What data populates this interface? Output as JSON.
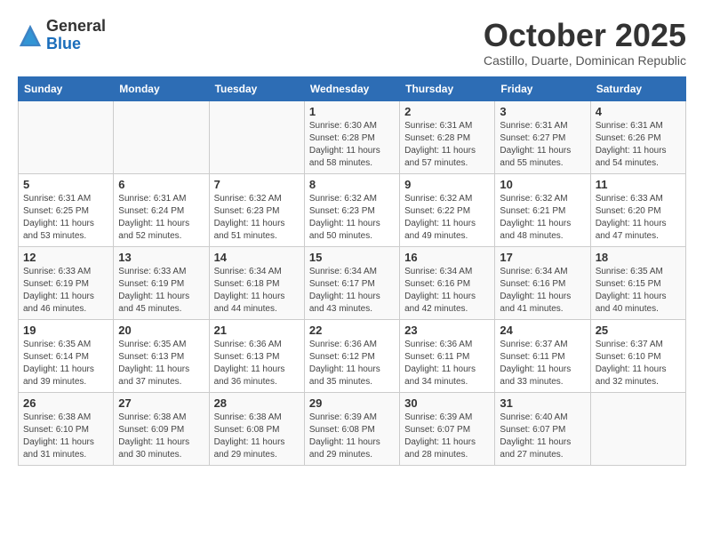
{
  "header": {
    "logo_general": "General",
    "logo_blue": "Blue",
    "month": "October 2025",
    "location": "Castillo, Duarte, Dominican Republic"
  },
  "days_of_week": [
    "Sunday",
    "Monday",
    "Tuesday",
    "Wednesday",
    "Thursday",
    "Friday",
    "Saturday"
  ],
  "weeks": [
    [
      {
        "day": "",
        "info": ""
      },
      {
        "day": "",
        "info": ""
      },
      {
        "day": "",
        "info": ""
      },
      {
        "day": "1",
        "info": "Sunrise: 6:30 AM\nSunset: 6:28 PM\nDaylight: 11 hours\nand 58 minutes."
      },
      {
        "day": "2",
        "info": "Sunrise: 6:31 AM\nSunset: 6:28 PM\nDaylight: 11 hours\nand 57 minutes."
      },
      {
        "day": "3",
        "info": "Sunrise: 6:31 AM\nSunset: 6:27 PM\nDaylight: 11 hours\nand 55 minutes."
      },
      {
        "day": "4",
        "info": "Sunrise: 6:31 AM\nSunset: 6:26 PM\nDaylight: 11 hours\nand 54 minutes."
      }
    ],
    [
      {
        "day": "5",
        "info": "Sunrise: 6:31 AM\nSunset: 6:25 PM\nDaylight: 11 hours\nand 53 minutes."
      },
      {
        "day": "6",
        "info": "Sunrise: 6:31 AM\nSunset: 6:24 PM\nDaylight: 11 hours\nand 52 minutes."
      },
      {
        "day": "7",
        "info": "Sunrise: 6:32 AM\nSunset: 6:23 PM\nDaylight: 11 hours\nand 51 minutes."
      },
      {
        "day": "8",
        "info": "Sunrise: 6:32 AM\nSunset: 6:23 PM\nDaylight: 11 hours\nand 50 minutes."
      },
      {
        "day": "9",
        "info": "Sunrise: 6:32 AM\nSunset: 6:22 PM\nDaylight: 11 hours\nand 49 minutes."
      },
      {
        "day": "10",
        "info": "Sunrise: 6:32 AM\nSunset: 6:21 PM\nDaylight: 11 hours\nand 48 minutes."
      },
      {
        "day": "11",
        "info": "Sunrise: 6:33 AM\nSunset: 6:20 PM\nDaylight: 11 hours\nand 47 minutes."
      }
    ],
    [
      {
        "day": "12",
        "info": "Sunrise: 6:33 AM\nSunset: 6:19 PM\nDaylight: 11 hours\nand 46 minutes."
      },
      {
        "day": "13",
        "info": "Sunrise: 6:33 AM\nSunset: 6:19 PM\nDaylight: 11 hours\nand 45 minutes."
      },
      {
        "day": "14",
        "info": "Sunrise: 6:34 AM\nSunset: 6:18 PM\nDaylight: 11 hours\nand 44 minutes."
      },
      {
        "day": "15",
        "info": "Sunrise: 6:34 AM\nSunset: 6:17 PM\nDaylight: 11 hours\nand 43 minutes."
      },
      {
        "day": "16",
        "info": "Sunrise: 6:34 AM\nSunset: 6:16 PM\nDaylight: 11 hours\nand 42 minutes."
      },
      {
        "day": "17",
        "info": "Sunrise: 6:34 AM\nSunset: 6:16 PM\nDaylight: 11 hours\nand 41 minutes."
      },
      {
        "day": "18",
        "info": "Sunrise: 6:35 AM\nSunset: 6:15 PM\nDaylight: 11 hours\nand 40 minutes."
      }
    ],
    [
      {
        "day": "19",
        "info": "Sunrise: 6:35 AM\nSunset: 6:14 PM\nDaylight: 11 hours\nand 39 minutes."
      },
      {
        "day": "20",
        "info": "Sunrise: 6:35 AM\nSunset: 6:13 PM\nDaylight: 11 hours\nand 37 minutes."
      },
      {
        "day": "21",
        "info": "Sunrise: 6:36 AM\nSunset: 6:13 PM\nDaylight: 11 hours\nand 36 minutes."
      },
      {
        "day": "22",
        "info": "Sunrise: 6:36 AM\nSunset: 6:12 PM\nDaylight: 11 hours\nand 35 minutes."
      },
      {
        "day": "23",
        "info": "Sunrise: 6:36 AM\nSunset: 6:11 PM\nDaylight: 11 hours\nand 34 minutes."
      },
      {
        "day": "24",
        "info": "Sunrise: 6:37 AM\nSunset: 6:11 PM\nDaylight: 11 hours\nand 33 minutes."
      },
      {
        "day": "25",
        "info": "Sunrise: 6:37 AM\nSunset: 6:10 PM\nDaylight: 11 hours\nand 32 minutes."
      }
    ],
    [
      {
        "day": "26",
        "info": "Sunrise: 6:38 AM\nSunset: 6:10 PM\nDaylight: 11 hours\nand 31 minutes."
      },
      {
        "day": "27",
        "info": "Sunrise: 6:38 AM\nSunset: 6:09 PM\nDaylight: 11 hours\nand 30 minutes."
      },
      {
        "day": "28",
        "info": "Sunrise: 6:38 AM\nSunset: 6:08 PM\nDaylight: 11 hours\nand 29 minutes."
      },
      {
        "day": "29",
        "info": "Sunrise: 6:39 AM\nSunset: 6:08 PM\nDaylight: 11 hours\nand 29 minutes."
      },
      {
        "day": "30",
        "info": "Sunrise: 6:39 AM\nSunset: 6:07 PM\nDaylight: 11 hours\nand 28 minutes."
      },
      {
        "day": "31",
        "info": "Sunrise: 6:40 AM\nSunset: 6:07 PM\nDaylight: 11 hours\nand 27 minutes."
      },
      {
        "day": "",
        "info": ""
      }
    ]
  ]
}
